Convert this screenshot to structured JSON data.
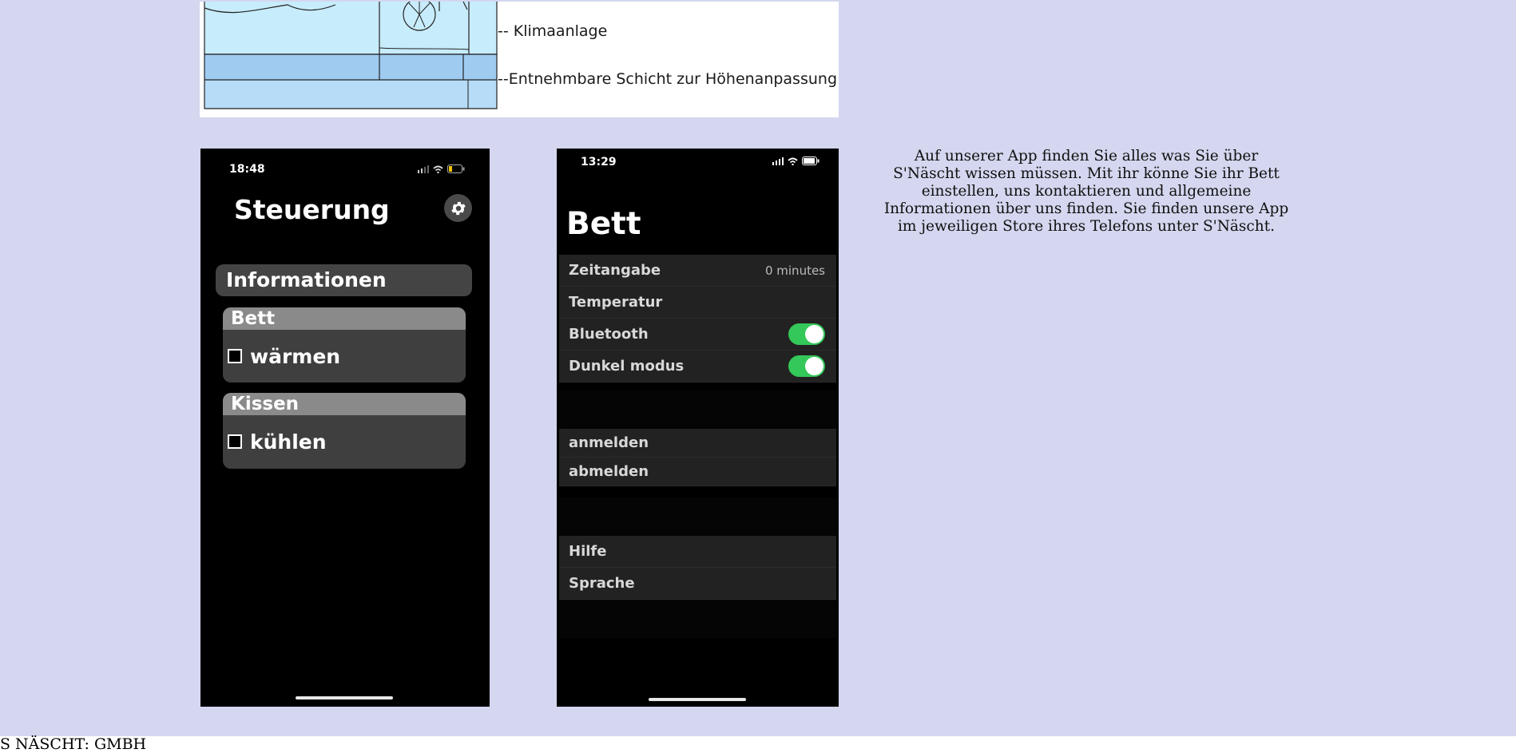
{
  "illustration": {
    "label_ac": "-- Klimaanlage",
    "label_layer": "--Entnehmbare Schicht zur Höhenanpassung"
  },
  "phone_control": {
    "status_time": "18:48",
    "title": "Steuerung",
    "info_label": "Informationen",
    "cards": [
      {
        "title": "Bett",
        "option": "wärmen"
      },
      {
        "title": "Kissen",
        "option": "kühlen"
      }
    ],
    "icons": [
      "gear-icon",
      "signal-icon",
      "wifi-icon",
      "battery-icon"
    ]
  },
  "phone_settings": {
    "status_time": "13:29",
    "title": "Bett",
    "rows": {
      "zeitangabe": {
        "label": "Zeitangabe",
        "value": "0 minutes"
      },
      "temperatur": {
        "label": "Temperatur"
      },
      "bluetooth": {
        "label": "Bluetooth",
        "on": true
      },
      "dunkel": {
        "label": "Dunkel modus",
        "on": true
      }
    },
    "account": {
      "login": "anmelden",
      "logout": "abmelden"
    },
    "support": {
      "help": "Hilfe",
      "language": "Sprache"
    },
    "toggle_color": "#34c759"
  },
  "description": "Auf unserer App finden Sie alles was Sie über S'Näscht wissen müssen. Mit ihr könne Sie ihr Bett einstellen, uns kontaktieren und allgemeine Informationen über uns finden. Sie finden unsere App im jeweiligen Store ihres Telefons unter S'Näscht.",
  "footer": "S NÄSCHT: GMBH",
  "colors": {
    "page_background": "#d4d7ef",
    "phone_background": "#000000"
  }
}
